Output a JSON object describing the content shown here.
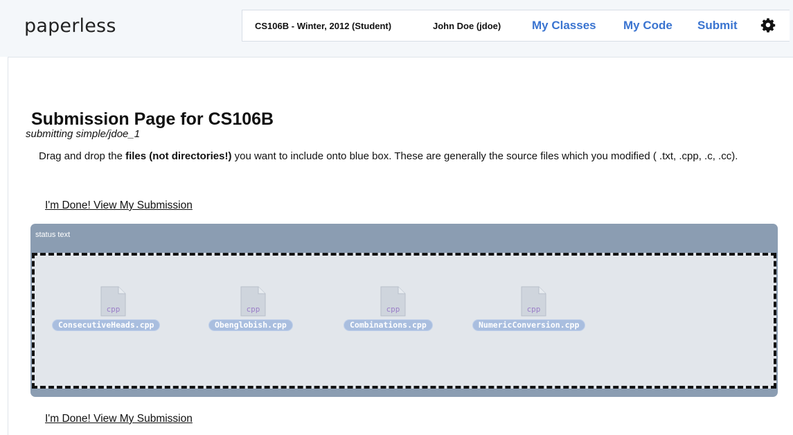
{
  "header": {
    "logo": "paperless",
    "course": "CS106B - Winter, 2012 (Student)",
    "user": "John Doe (jdoe)",
    "nav": [
      "My Classes",
      "My Code",
      "Submit"
    ],
    "settings_icon": "gear-icon"
  },
  "page": {
    "title": "Submission Page for CS106B",
    "subtitle": "submitting simple/jdoe_1",
    "instructions": {
      "before": "Drag and drop the ",
      "bold": "files (not directories!)",
      "after": " you want to include onto blue box. These are generally the source files which you modified ( .txt, .cpp, .c, .cc)."
    },
    "done_link_top": "I'm Done! View My Submission",
    "done_link_bottom": "I'm Done! View My Submission"
  },
  "dropbox": {
    "status": "status text",
    "files": [
      {
        "name": "ConsecutiveHeads.cpp",
        "ext": "cpp"
      },
      {
        "name": "Obenglobish.cpp",
        "ext": "cpp"
      },
      {
        "name": "Combinations.cpp",
        "ext": "cpp"
      },
      {
        "name": "NumericConversion.cpp",
        "ext": "cpp"
      }
    ]
  },
  "colors": {
    "link": "#3a74d0",
    "panel": "#8b9db2",
    "dropzone": "#e2e6eb",
    "file_pill": "#a9bedf",
    "file_ext": "#9b7fc8"
  }
}
